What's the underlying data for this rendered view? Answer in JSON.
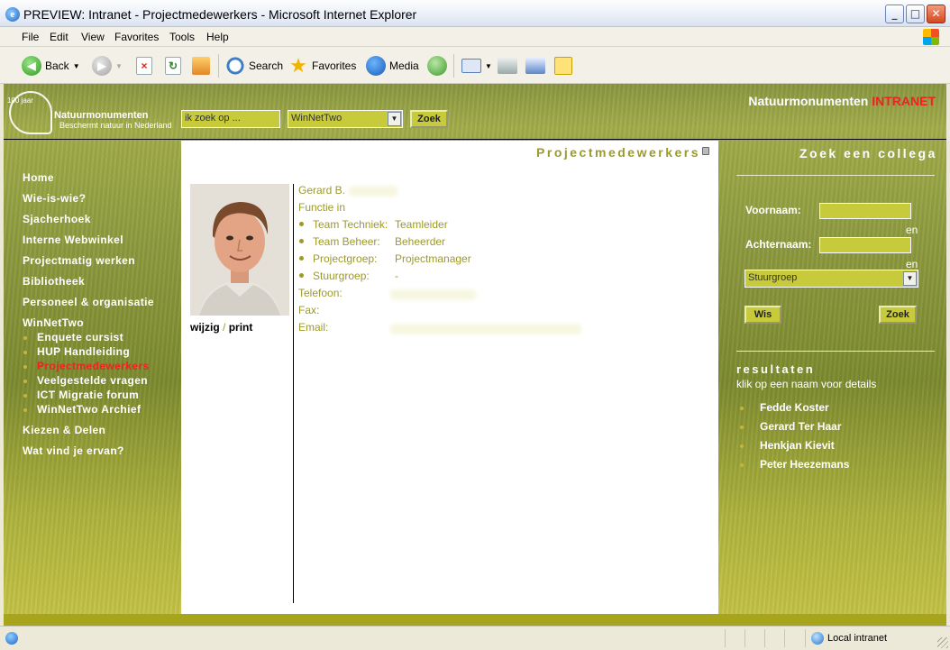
{
  "window": {
    "title": "PREVIEW: Intranet - Projectmedewerkers - Microsoft Internet Explorer",
    "icon": "ie-icon"
  },
  "menubar": {
    "items": [
      "File",
      "Edit",
      "View",
      "Favorites",
      "Tools",
      "Help"
    ]
  },
  "toolbar": {
    "back_label": "Back",
    "search_label": "Search",
    "favorites_label": "Favorites",
    "media_label": "Media"
  },
  "header": {
    "logo_name": "Natuurmonumenten",
    "logo_tagline": "Beschermt natuur in Nederland",
    "logo_badge": "100 jaar",
    "search_placeholder": "ik zoek op ...",
    "select_value": "WinNetTwo",
    "search_button": "Zoek",
    "brand_name": "Natuurmonumenten",
    "brand_suffix": "INTRANET",
    "brand_suffix_color": "#e22222"
  },
  "nav": {
    "items": [
      "Home",
      "Wie-is-wie?",
      "Sjacherhoek",
      "Interne Webwinkel",
      "Projectmatig werken",
      "Bibliotheek",
      "Personeel & organisatie",
      "WinNetTwo"
    ],
    "sub_items": [
      "Enquete cursist",
      "HUP Handleiding",
      "Projectmedewerkers",
      "Veelgestelde vragen",
      "ICT Migratie forum",
      "WinNetTwo Archief"
    ],
    "active_sub": "Projectmedewerkers",
    "after_items": [
      "Kiezen & Delen",
      "Wat vind je ervan?"
    ]
  },
  "main": {
    "title": "Projectmedewerkers",
    "photo_edit": "wijzig",
    "photo_sep": "/",
    "photo_print": "print",
    "name": "Gerard B.",
    "functie_label": "Functie in",
    "rows": [
      {
        "label": "Team Techniek:",
        "value": "Teamleider"
      },
      {
        "label": "Team Beheer:",
        "value": "Beheerder"
      },
      {
        "label": "Projectgroep:",
        "value": "Projectmanager"
      },
      {
        "label": "Stuurgroep:",
        "value": "-"
      }
    ],
    "telefoon_label": "Telefoon:",
    "fax_label": "Fax:",
    "email_label": "Email:"
  },
  "sidebar": {
    "title": "Zoek een collega",
    "voornaam_label": "Voornaam:",
    "achternaam_label": "Achternaam:",
    "en1": "en",
    "en2": "en",
    "select_value": "Stuurgroep",
    "wis_button": "Wis",
    "zoek_button": "Zoek",
    "results_title": "resultaten",
    "results_subtitle": "klik op een naam voor details",
    "results": [
      "Fedde Koster",
      "Gerard Ter Haar",
      "Henkjan Kievit",
      "Peter Heezemans"
    ]
  },
  "statusbar": {
    "zone": "Local intranet"
  },
  "colors": {
    "olive_text": "#9b9a2a",
    "field_bg": "#c7ca3a",
    "footer_bar": "#a6a51b"
  }
}
